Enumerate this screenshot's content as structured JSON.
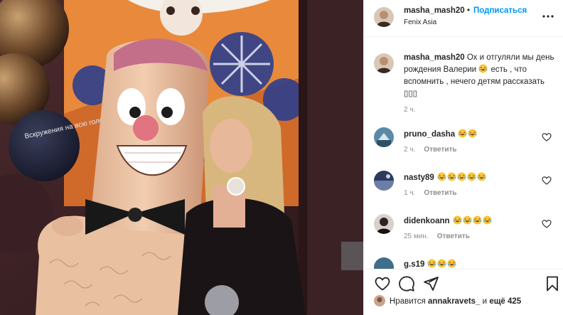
{
  "post": {
    "username": "masha_mash20",
    "dot": "•",
    "follow_label": "Подписаться",
    "location": "Fenix Asia",
    "more_icon": "more-horizontal-icon",
    "balloon_text": "Вскружения на всю голову"
  },
  "caption": {
    "username": "masha_mash20",
    "text_part1": " Ох и отгуляли мы день рождения Валерии ",
    "text_part2": " есть , что вспомнить , нечего детям рассказать ",
    "trailing_glyphs": "▯▯▯",
    "time": "2 ч."
  },
  "comments": [
    {
      "username": "pruno_dasha",
      "emoji_count": 2,
      "time": "2 ч.",
      "reply": "Ответить"
    },
    {
      "username": "nasty89",
      "emoji_count": 5,
      "time": "1 ч.",
      "reply": "Ответить"
    },
    {
      "username": "didenkoann",
      "emoji_count": 4,
      "time": "25 мин.",
      "reply": "Ответить"
    },
    {
      "username": "g.s19",
      "emoji_count": 3,
      "time": "",
      "reply": ""
    }
  ],
  "actions": {
    "like_icon": "heart-icon",
    "comment_icon": "comment-icon",
    "share_icon": "paper-plane-icon",
    "save_icon": "bookmark-icon"
  },
  "likes": {
    "prefix": "Нравится ",
    "user": "annakravets_",
    "middle": " и ",
    "count": "ещё 425"
  },
  "colors": {
    "follow": "#0095f6",
    "secondary_text": "#8e8e8e",
    "border": "#efefef"
  }
}
